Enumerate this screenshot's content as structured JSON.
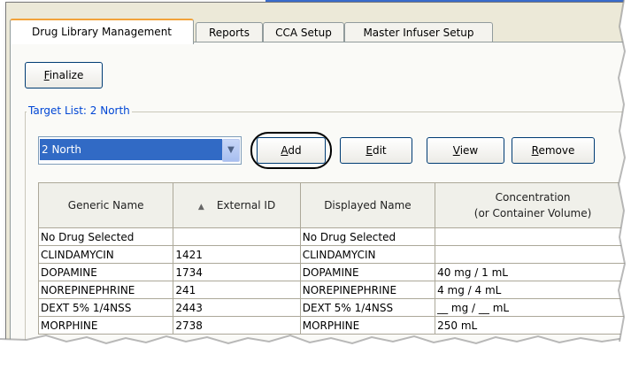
{
  "tabs": [
    {
      "label": "Drug Library Management",
      "active": true
    },
    {
      "label": "Reports"
    },
    {
      "label": "CCA Setup"
    },
    {
      "label": "Master Infuser Setup"
    }
  ],
  "finalize": {
    "label_rest": "inalize",
    "mnemonic": "F"
  },
  "target_list": {
    "label": "Target List: 2 North",
    "selected": "2 North",
    "buttons": {
      "add": {
        "mnemonic": "A",
        "rest": "dd"
      },
      "edit": {
        "mnemonic": "E",
        "rest": "dit"
      },
      "view": {
        "mnemonic": "V",
        "rest": "iew"
      },
      "remove": {
        "mnemonic": "R",
        "rest": "emove"
      }
    }
  },
  "table": {
    "columns": [
      "Generic Name",
      "External ID",
      "Displayed Name",
      "Concentration\n(or Container Volume)"
    ],
    "sort_indicator": "▲",
    "rows": [
      [
        "No Drug Selected",
        "",
        "No Drug Selected",
        ""
      ],
      [
        "CLINDAMYCIN",
        "1421",
        "CLINDAMYCIN",
        ""
      ],
      [
        "DOPAMINE",
        "1734",
        "DOPAMINE",
        "40 mg / 1 mL"
      ],
      [
        "NOREPINEPHRINE",
        "241",
        "NOREPINEPHRINE",
        "4 mg / 4 mL"
      ],
      [
        "DEXT 5% 1/4NSS",
        "2443",
        "DEXT 5% 1/4NSS",
        "__ mg / __ mL"
      ],
      [
        "MORPHINE",
        "2738",
        "MORPHINE",
        "250 mL"
      ]
    ]
  },
  "colors": {
    "accent": "#316ac5",
    "group_label": "#0046d5",
    "tab_highlight": "#f2a33a"
  }
}
